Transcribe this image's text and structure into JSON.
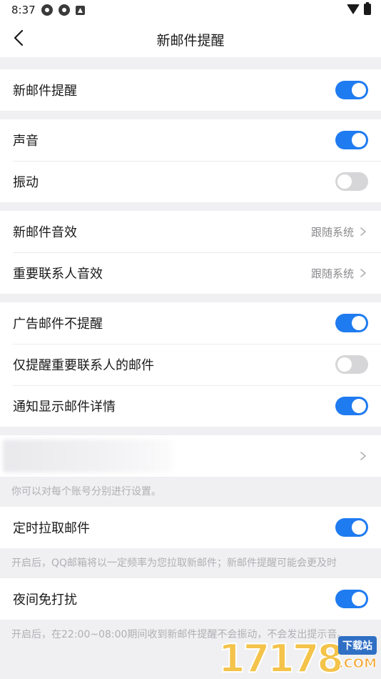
{
  "status_bar": {
    "time": "8:37",
    "icons": [
      "notification-app-icon",
      "notification-app-icon",
      "notification-a-icon"
    ],
    "right_icons": [
      "wifi-icon",
      "battery-icon"
    ]
  },
  "header": {
    "title": "新邮件提醒",
    "back_icon": "chevron-left-icon"
  },
  "sections": {
    "new_mail": {
      "label": "新邮件提醒",
      "on": true
    },
    "sound": {
      "label": "声音",
      "on": true
    },
    "vibrate": {
      "label": "振动",
      "on": false
    },
    "new_mail_sound": {
      "label": "新邮件音效",
      "value": "跟随系统"
    },
    "vip_sound": {
      "label": "重要联系人音效",
      "value": "跟随系统"
    },
    "ad_mail": {
      "label": "广告邮件不提醒",
      "on": true
    },
    "vip_only": {
      "label": "仅提醒重要联系人的邮件",
      "on": false
    },
    "show_detail": {
      "label": "通知显示邮件详情",
      "on": true
    },
    "account_hint": "你可以对每个账号分别进行设置。",
    "timed_fetch": {
      "label": "定时拉取邮件",
      "on": true
    },
    "timed_fetch_hint": "开启后，QQ邮箱将以一定频率为您拉取新邮件；新邮件提醒可能会更及时",
    "night_mode": {
      "label": "夜间免打扰",
      "on": true
    },
    "night_mode_hint": "开启后，在22:00~08:00期间收到新邮件提醒不会振动，不会发出提示音。"
  },
  "watermark": {
    "digits": "17178",
    "badge": "下载站",
    "suffix": ".COM"
  },
  "colors": {
    "accent": "#1f7bf0",
    "toggle_off": "#d6d6d8",
    "background": "#f0f0f2"
  }
}
